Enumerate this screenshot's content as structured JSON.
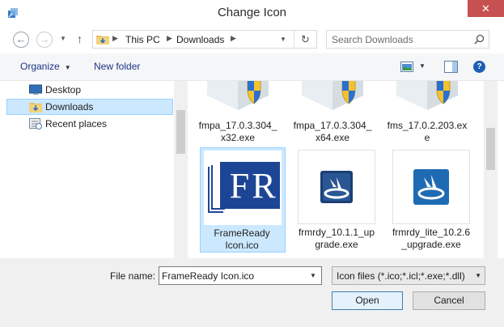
{
  "window": {
    "title": "Change Icon",
    "close_glyph": "✕"
  },
  "nav": {
    "back_glyph": "←",
    "forward_glyph": "→",
    "up_glyph": "↑",
    "breadcrumb": [
      "This PC",
      "Downloads"
    ],
    "search_placeholder": "Search Downloads"
  },
  "toolbar": {
    "organize_label": "Organize",
    "new_folder_label": "New folder",
    "help_glyph": "?"
  },
  "sidebar": {
    "items": [
      {
        "label": "Desktop",
        "icon": "desktop-icon",
        "selected": false
      },
      {
        "label": "Downloads",
        "icon": "downloads-folder-icon",
        "selected": true
      },
      {
        "label": "Recent places",
        "icon": "recent-places-icon",
        "selected": false
      }
    ]
  },
  "files": [
    {
      "name_line1": "fmpa_17.0.3.304_",
      "name_line2": "x32.exe",
      "icon": "installer-shield-icon",
      "selected": false
    },
    {
      "name_line1": "fmpa_17.0.3.304_",
      "name_line2": "x64.exe",
      "icon": "installer-shield-icon",
      "selected": false
    },
    {
      "name_line1": "fms_17.0.2.203.ex",
      "name_line2": "e",
      "icon": "installer-shield-icon",
      "selected": false
    },
    {
      "name_line1": "FrameReady",
      "name_line2": "Icon.ico",
      "icon": "frameready-logo-icon",
      "logo_text": "FR",
      "selected": true
    },
    {
      "name_line1": "frmrdy_10.1.1_up",
      "name_line2": "grade.exe",
      "icon": "frmrdy-app-icon",
      "selected": false
    },
    {
      "name_line1": "frmrdy_lite_10.2.6",
      "name_line2": "_upgrade.exe",
      "icon": "frmrdy-lite-app-icon",
      "selected": false
    }
  ],
  "footer": {
    "file_name_label": "File name:",
    "file_name_value": "FrameReady Icon.ico",
    "file_type_value": "Icon files (*.ico;*.icl;*.exe;*.dll)",
    "open_label": "Open",
    "cancel_label": "Cancel"
  },
  "colors": {
    "selection_bg": "#cce8ff",
    "selection_border": "#99d1ff",
    "close_button": "#c75050",
    "link_text": "#1e3287",
    "frameready_blue": "#1d4596"
  }
}
